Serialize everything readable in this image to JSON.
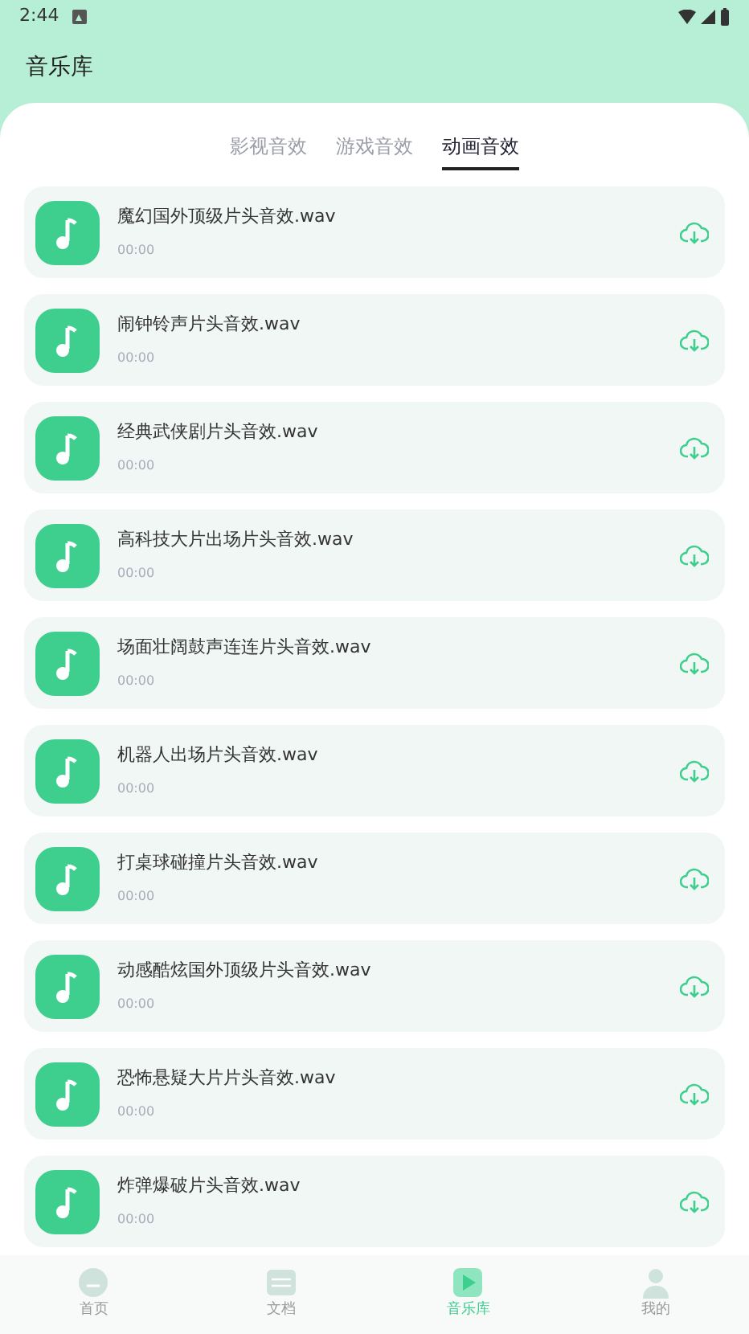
{
  "status_bar": {
    "time": "2:44"
  },
  "header": {
    "title": "音乐库"
  },
  "tabs": [
    {
      "label": "影视音效",
      "selected": false
    },
    {
      "label": "游戏音效",
      "selected": false
    },
    {
      "label": "动画音效",
      "selected": true
    }
  ],
  "tracks": [
    {
      "name": "魔幻国外顶级片头音效.wav",
      "duration": "00:00"
    },
    {
      "name": "闹钟铃声片头音效.wav",
      "duration": "00:00"
    },
    {
      "name": "经典武侠剧片头音效.wav",
      "duration": "00:00"
    },
    {
      "name": "高科技大片出场片头音效.wav",
      "duration": "00:00"
    },
    {
      "name": "场面壮阔鼓声连连片头音效.wav",
      "duration": "00:00"
    },
    {
      "name": "机器人出场片头音效.wav",
      "duration": "00:00"
    },
    {
      "name": "打桌球碰撞片头音效.wav",
      "duration": "00:00"
    },
    {
      "name": "动感酷炫国外顶级片头音效.wav",
      "duration": "00:00"
    },
    {
      "name": "恐怖悬疑大片片头音效.wav",
      "duration": "00:00"
    },
    {
      "name": "炸弹爆破片头音效.wav",
      "duration": "00:00"
    }
  ],
  "bottom_nav": [
    {
      "label": "首页",
      "kind": "home",
      "selected": false
    },
    {
      "label": "文档",
      "kind": "docs",
      "selected": false
    },
    {
      "label": "音乐库",
      "kind": "music",
      "selected": true
    },
    {
      "label": "我的",
      "kind": "profile",
      "selected": false
    }
  ]
}
